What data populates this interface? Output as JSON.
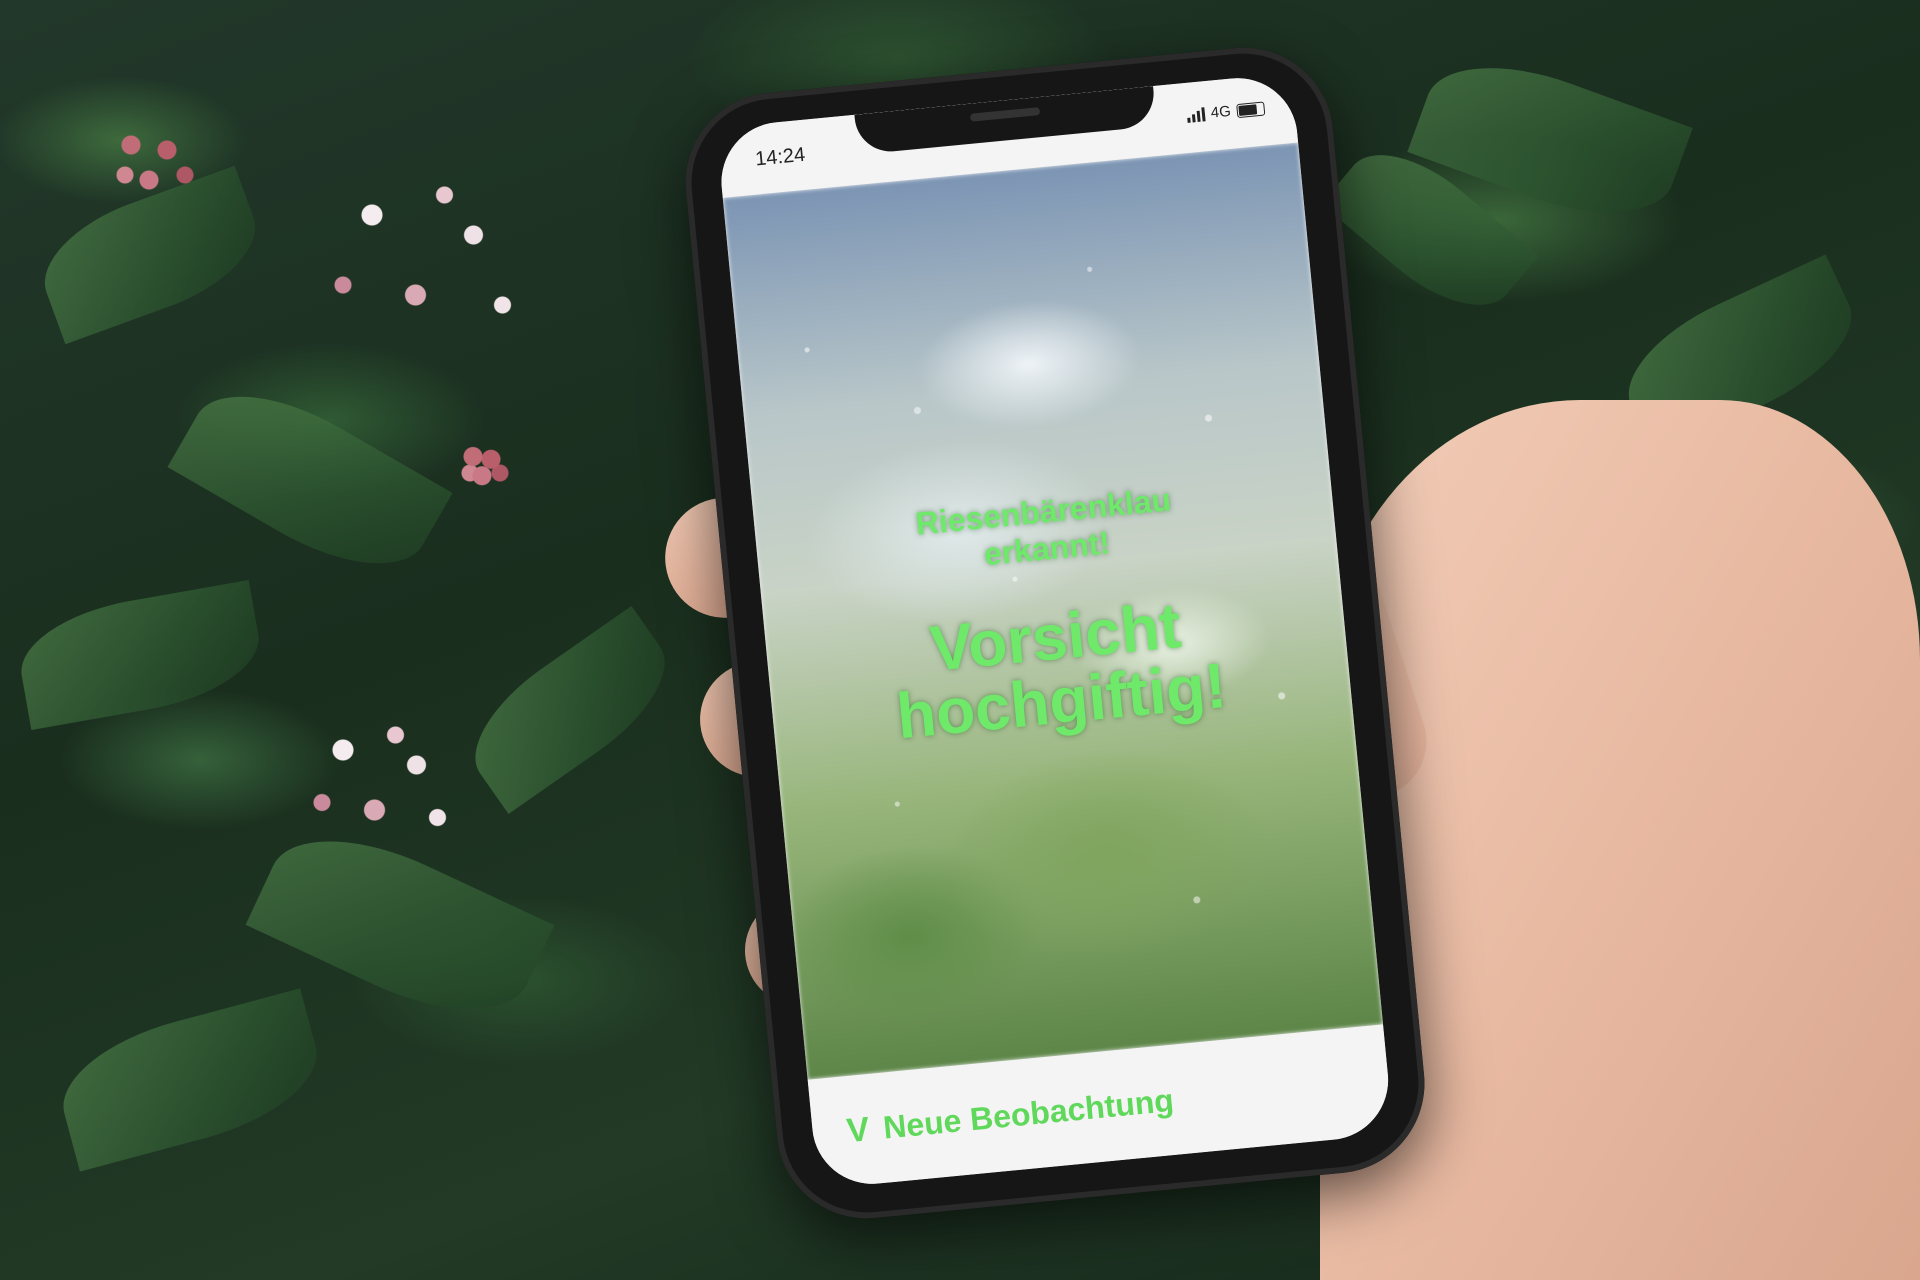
{
  "status_bar": {
    "time": "14:24",
    "network": "4G"
  },
  "alert": {
    "detected_line1": "Riesenbärenklau",
    "detected_line2": "erkannt!",
    "warning_line1": "Vorsicht",
    "warning_line2": "hochgiftig!"
  },
  "bottom_action": {
    "icon": "chevron-down-icon",
    "glyph": "V",
    "label": "Neue Beobachtung"
  },
  "colors": {
    "accent_green": "#6fe96a",
    "screen_bg": "#f4f4f4",
    "phone_frame": "#161616"
  }
}
